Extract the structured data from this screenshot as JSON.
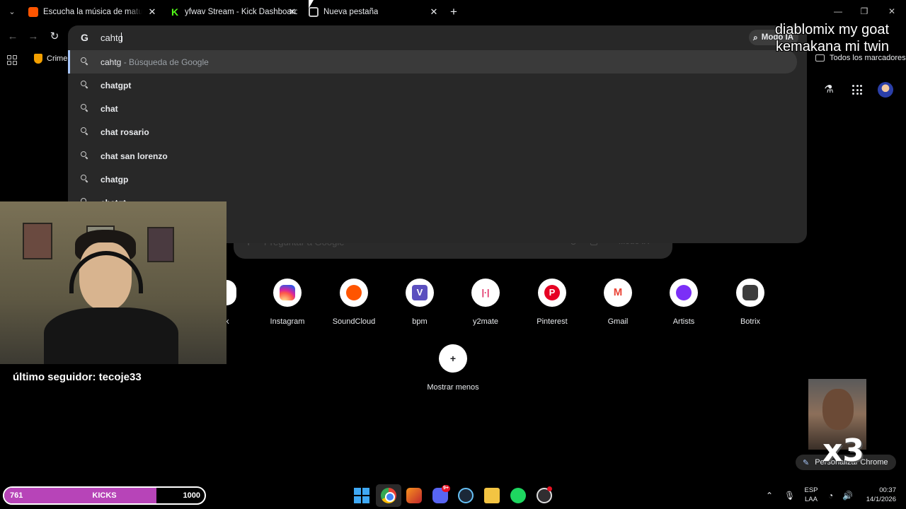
{
  "tabs": [
    {
      "title": "Escucha la música de matumora",
      "favicon": "soundcloud-icon"
    },
    {
      "title": "yfwav Stream - Kick Dashboard",
      "favicon": "kick-icon"
    },
    {
      "title": "Nueva pestaña",
      "favicon": "chrome-icon",
      "active": true
    }
  ],
  "omnibox": {
    "value": "cahtg",
    "modo_ia": "Modo IA"
  },
  "suggestions": [
    {
      "text": "cahtg",
      "sub": " - Búsqueda de Google",
      "selected": true
    },
    {
      "text": "chatgpt"
    },
    {
      "text": "chat"
    },
    {
      "text": "chat rosario"
    },
    {
      "text": "chat san lorenzo"
    },
    {
      "text": "chatgp"
    },
    {
      "text": "chatgt"
    }
  ],
  "bookmarks": {
    "first": "Crimen",
    "all": "Todos los marcadores"
  },
  "ntp": {
    "search_placeholder": "Preguntar a Google",
    "modo_ia": "Modo IA",
    "partial_shortcut_label": "k",
    "shortcuts": [
      {
        "label": "Instagram",
        "icon": "instagram-icon"
      },
      {
        "label": "SoundCloud",
        "icon": "soundcloud-icon"
      },
      {
        "label": "bpm",
        "icon": "bpm-icon",
        "glyph": "V"
      },
      {
        "label": "y2mate",
        "icon": "y2mate-icon",
        "glyph": "|·|"
      },
      {
        "label": "Pinterest",
        "icon": "pinterest-icon",
        "glyph": "P"
      },
      {
        "label": "Gmail",
        "icon": "gmail-icon",
        "glyph": "M"
      },
      {
        "label": "Artists",
        "icon": "spotify-icon"
      },
      {
        "label": "Botrix",
        "icon": "botrix-icon"
      }
    ],
    "show_less": "Mostrar menos",
    "customize": "Personalizar Chrome"
  },
  "overlay": {
    "line1": "diablomix my goat",
    "line2": "kemakana mi twin",
    "follower": "último seguidor: tecoje33",
    "multiplier": "x3",
    "kicks": {
      "current": "761",
      "label": "KICKS",
      "goal": "1000",
      "progress": 0.761
    }
  },
  "taskbar": {
    "lang1": "ESP",
    "lang2": "LAA",
    "time": "00:37",
    "date": "14/1/2026",
    "discord_badge": "9+"
  }
}
